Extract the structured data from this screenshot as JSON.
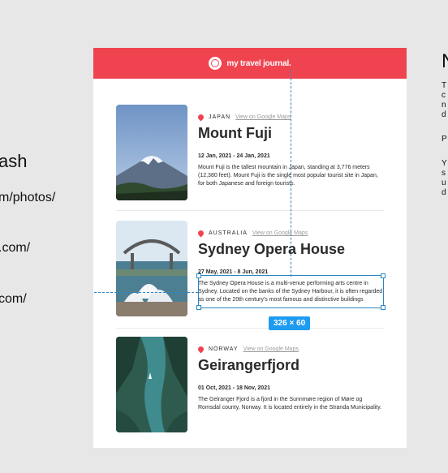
{
  "left_fragments": [
    "ash",
    "m/photos/",
    ".com/",
    "com/"
  ],
  "right_fragments": {
    "heading": "N",
    "lines": [
      "T",
      "c",
      "n",
      "d",
      "P",
      "Y",
      "s",
      "u",
      "d"
    ]
  },
  "header": {
    "brand": "my travel journal."
  },
  "entries": [
    {
      "country": "JAPAN",
      "maps_link": "View on Google Maps",
      "title": "Mount Fuji",
      "dates": "12 Jan, 2021 - 24 Jan, 2021",
      "description": "Mount Fuji is the tallest mountain in Japan, standing at 3,776 meters (12,380 feet). Mount Fuji is the single most popular tourist site in Japan, for both Japanese and foreign tourists."
    },
    {
      "country": "AUSTRALIA",
      "maps_link": "View on Google Maps",
      "title": "Sydney Opera House",
      "dates": "27 May, 2021 - 8 Jun, 2021",
      "description": "The Sydney Opera House is a multi-venue performing arts centre in Sydney. Located on the banks of the Sydney Harbour, it is often regarded as one of the 20th century's most famous and distinctive buildings"
    },
    {
      "country": "NORWAY",
      "maps_link": "View on Google Maps",
      "title": "Geirangerfjord",
      "dates": "01 Oct, 2021 - 18 Nov, 2021",
      "description": "The Geiranger Fjord is a fjord in the Sunnmøre region of Møre og Romsdal county, Norway. It is located entirely in the Stranda Municipality."
    }
  ],
  "selection": {
    "dimensions": "326 × 60"
  },
  "colors": {
    "accent": "#ef4450",
    "selection": "#1d9bf0"
  }
}
